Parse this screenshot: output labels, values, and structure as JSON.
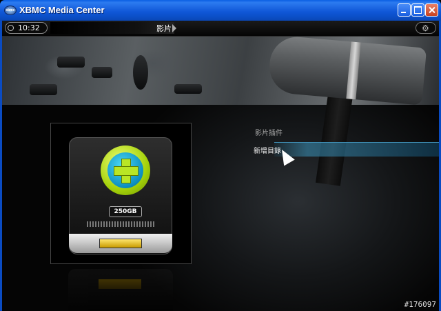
{
  "window": {
    "title": "XBMC Media Center",
    "app_icon_label": "xbmc"
  },
  "topbar": {
    "clock": "10:32",
    "section": "影片",
    "settings_icon": "gear-icon"
  },
  "menu": {
    "items": [
      {
        "label": "影片插件",
        "state": "normal"
      },
      {
        "label": "新增目錄",
        "state": "focused"
      }
    ]
  },
  "thumbnail": {
    "capacity_label": "250GB"
  },
  "watermark": "#176097",
  "colors": {
    "titlebar": "#1158d8",
    "focus": "#3f8fb5",
    "plus_ring": "#a5d20a",
    "plus_inner": "#0d8ec0"
  }
}
